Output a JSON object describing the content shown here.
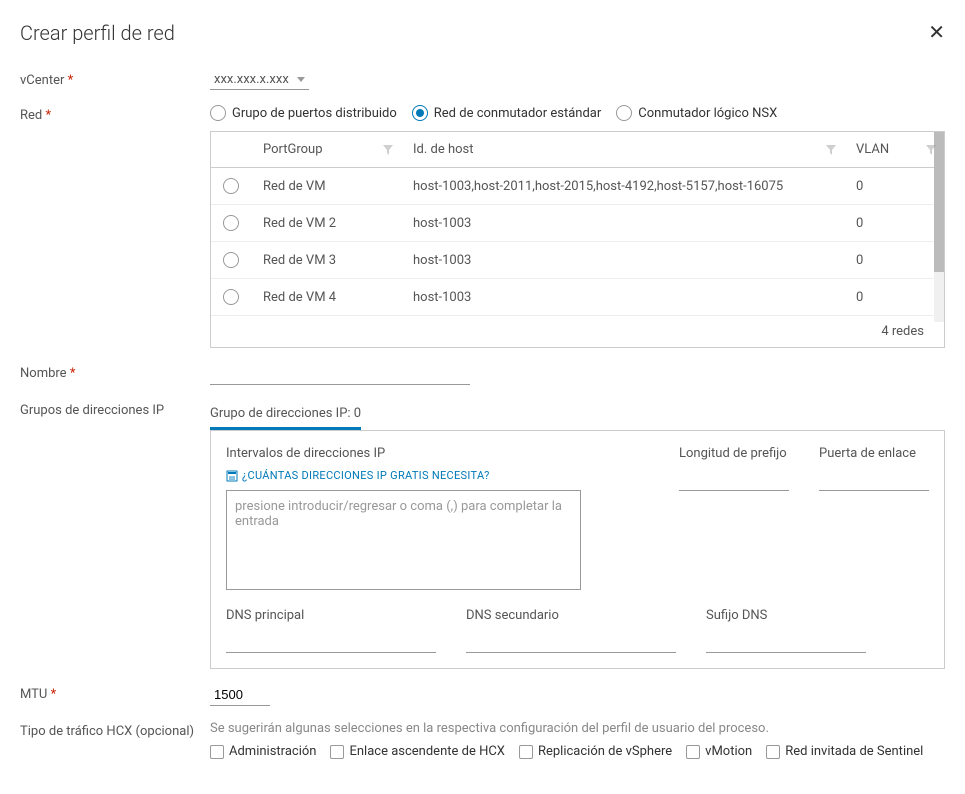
{
  "header": {
    "title": "Crear perfil de red"
  },
  "fields": {
    "vcenter_label": "vCenter",
    "vcenter_value": "xxx.xxx.x.xxx",
    "red_label": "Red",
    "radio_options": {
      "dpg": "Grupo de puertos distribuido",
      "std": "Red de conmutador estándar",
      "nsx": "Conmutador lógico NSX"
    },
    "nombre_label": "Nombre",
    "ip_groups_label": "Grupos de direcciones IP",
    "ip_tab": "Grupo de direcciones IP: 0",
    "mtu_label": "MTU",
    "mtu_value": "1500",
    "traffic_label": "Tipo de tráfico HCX (opcional)",
    "traffic_hint": "Se sugerirán algunas selecciones en la respectiva configuración del perfil de usuario del proceso.",
    "checkboxes": {
      "admin": "Administración",
      "uplink": "Enlace ascendente de HCX",
      "vsphere": "Replicación de vSphere",
      "vmotion": "vMotion",
      "sentinel": "Red invitada de Sentinel"
    }
  },
  "table": {
    "headers": {
      "portgroup": "PortGroup",
      "hostid": "Id. de host",
      "vlan": "VLAN"
    },
    "rows": [
      {
        "pg": "Red de VM",
        "host": "host-1003,host-2011,host-2015,host-4192,host-5157,host-16075",
        "vlan": "0"
      },
      {
        "pg": "Red de VM 2",
        "host": "host-1003",
        "vlan": "0"
      },
      {
        "pg": "Red de VM 3",
        "host": "host-1003",
        "vlan": "0"
      },
      {
        "pg": "Red de VM 4",
        "host": "host-1003",
        "vlan": "0"
      }
    ],
    "footer": "4 redes"
  },
  "ip_panel": {
    "ranges_label": "Intervalos de direcciones IP",
    "prefix_label": "Longitud de prefijo",
    "gateway_label": "Puerta de enlace",
    "help_link": "¿CUÁNTAS DIRECCIONES IP GRATIS NECESITA?",
    "textarea_placeholder": "presione introducir/regresar o coma (,) para completar la entrada",
    "dns_primary": "DNS principal",
    "dns_secondary": "DNS secundario",
    "dns_suffix": "Sufijo DNS"
  }
}
